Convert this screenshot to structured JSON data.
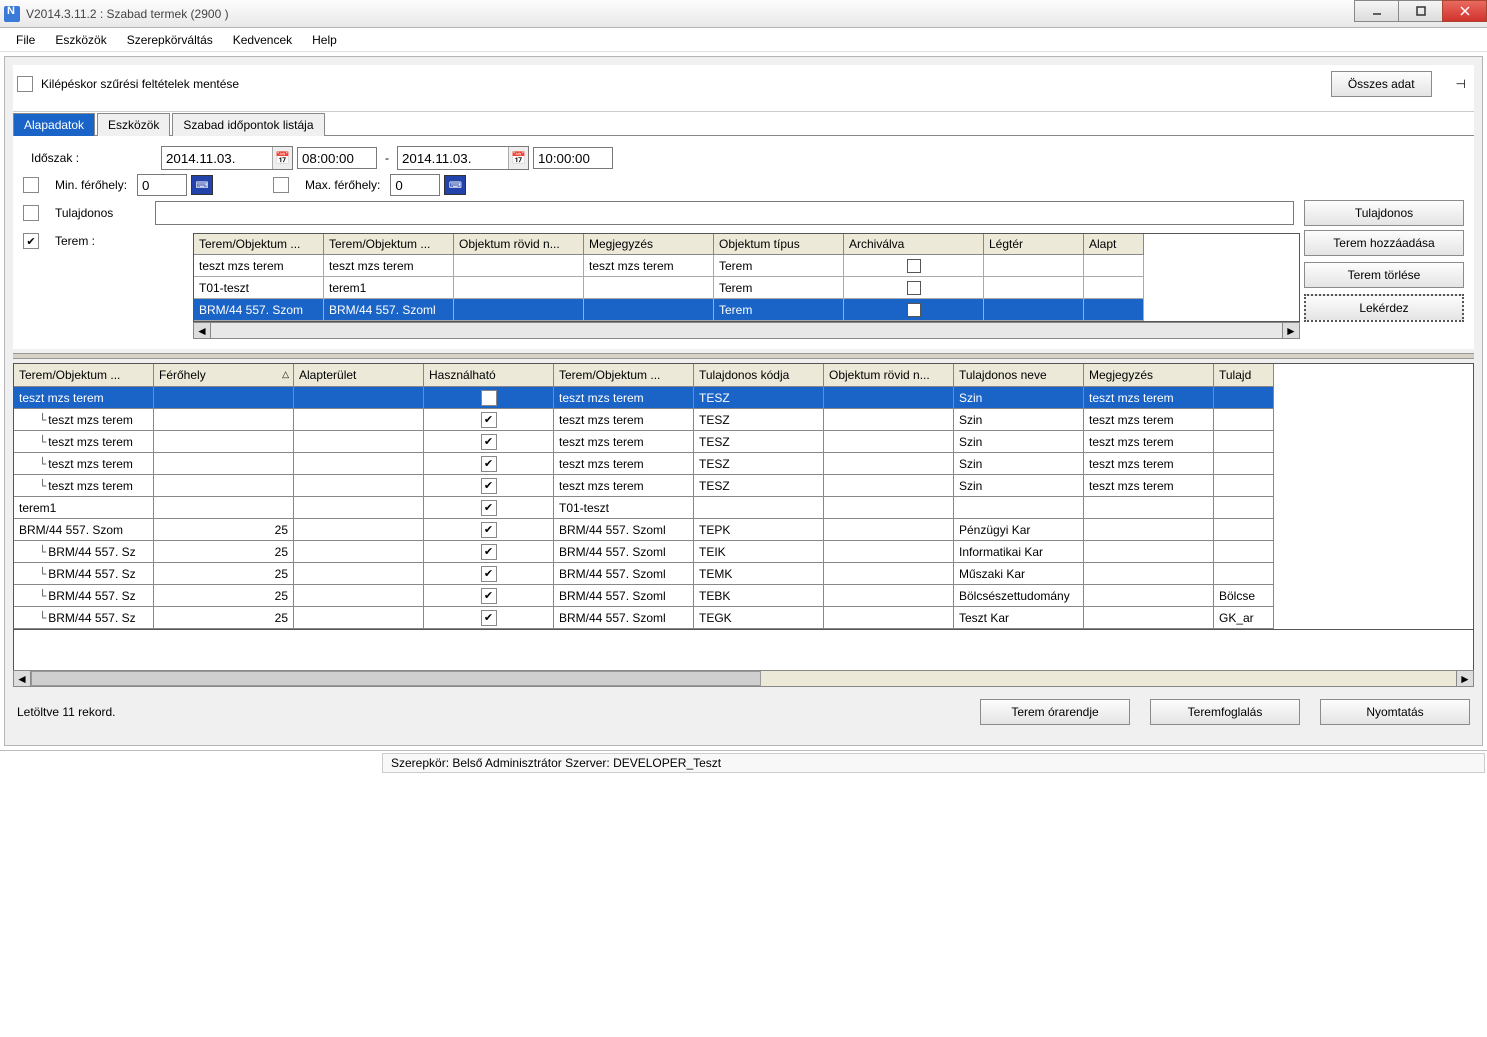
{
  "window": {
    "title": "V2014.3.11.2 : Szabad termek (2900  )"
  },
  "menu": [
    "File",
    "Eszközök",
    "Szerepkörváltás",
    "Kedvencek",
    "Help"
  ],
  "toolbar": {
    "save_filter_label": "Kilépéskor szűrési feltételek mentése",
    "all_data_btn": "Összes adat"
  },
  "tabs": [
    {
      "label": "Alapadatok",
      "active": true
    },
    {
      "label": "Eszközök",
      "active": false
    },
    {
      "label": "Szabad időpontok listája",
      "active": false
    }
  ],
  "filters": {
    "idoszak_label": "Időszak :",
    "date_from": "2014.11.03.",
    "time_from": "08:00:00",
    "date_to": "2014.11.03.",
    "time_to": "10:00:00",
    "min_ferhely_label": "Min. férőhely:",
    "min_ferhely": "0",
    "max_ferhely_label": "Max. férőhely:",
    "max_ferhely": "0",
    "tulajdonos_label": "Tulajdonos",
    "tulajdonos_value": "",
    "terem_label": "Terem :"
  },
  "buttons": {
    "tulajdonos": "Tulajdonos",
    "terem_add": "Terem hozzáadása",
    "terem_del": "Terem törlése",
    "lekerdez": "Lekérdez",
    "terem_orarend": "Terem órarendje",
    "teremfoglalas": "Teremfoglalás",
    "nyomtatas": "Nyomtatás"
  },
  "terem_grid": {
    "headers": [
      "Terem/Objektum ...",
      "Terem/Objektum ...",
      "Objektum rövid n...",
      "Megjegyzés",
      "Objektum típus",
      "Archiválva",
      "Légtér",
      "Alapt"
    ],
    "rows": [
      {
        "name": "teszt mzs terem",
        "name2": "teszt mzs terem",
        "rov": "",
        "meg": "teszt mzs terem",
        "tip": "Terem",
        "arch": false,
        "leg": "",
        "alap": "",
        "selected": false
      },
      {
        "name": "T01-teszt",
        "name2": "terem1",
        "rov": "",
        "meg": "",
        "tip": "Terem",
        "arch": false,
        "leg": "",
        "alap": "",
        "selected": false
      },
      {
        "name": "BRM/44 557. Szom",
        "name2": "BRM/44 557. Szoml",
        "rov": "",
        "meg": "",
        "tip": "Terem",
        "arch": false,
        "leg": "",
        "alap": "",
        "selected": true
      }
    ]
  },
  "main_grid": {
    "headers": [
      "Terem/Objektum ...",
      "Férőhely",
      "Alapterület",
      "Használható",
      "Terem/Objektum ...",
      "Tulajdonos kódja",
      "Objektum rövid n...",
      "Tulajdonos neve",
      "Megjegyzés",
      "Tulajd"
    ],
    "sort_col": 1,
    "rows": [
      {
        "indent": 0,
        "name": "teszt mzs terem",
        "fer": "",
        "alap": "",
        "haszn": true,
        "to": "teszt mzs terem",
        "tk": "TESZ",
        "or": "",
        "tn": "Szin",
        "meg": "teszt mzs terem",
        "tu": "",
        "selected": true
      },
      {
        "indent": 1,
        "name": "teszt mzs terem",
        "fer": "",
        "alap": "",
        "haszn": true,
        "to": "teszt mzs terem",
        "tk": "TESZ",
        "or": "",
        "tn": "Szin",
        "meg": "teszt mzs terem",
        "tu": "",
        "selected": false
      },
      {
        "indent": 1,
        "name": "teszt mzs terem",
        "fer": "",
        "alap": "",
        "haszn": true,
        "to": "teszt mzs terem",
        "tk": "TESZ",
        "or": "",
        "tn": "Szin",
        "meg": "teszt mzs terem",
        "tu": "",
        "selected": false
      },
      {
        "indent": 1,
        "name": "teszt mzs terem",
        "fer": "",
        "alap": "",
        "haszn": true,
        "to": "teszt mzs terem",
        "tk": "TESZ",
        "or": "",
        "tn": "Szin",
        "meg": "teszt mzs terem",
        "tu": "",
        "selected": false
      },
      {
        "indent": 1,
        "name": "teszt mzs terem",
        "fer": "",
        "alap": "",
        "haszn": true,
        "to": "teszt mzs terem",
        "tk": "TESZ",
        "or": "",
        "tn": "Szin",
        "meg": "teszt mzs terem",
        "tu": "",
        "selected": false
      },
      {
        "indent": 0,
        "name": "terem1",
        "fer": "",
        "alap": "",
        "haszn": true,
        "to": "T01-teszt",
        "tk": "",
        "or": "",
        "tn": "",
        "meg": "",
        "tu": "",
        "selected": false
      },
      {
        "indent": 0,
        "name": "BRM/44 557. Szom",
        "fer": "25",
        "alap": "",
        "haszn": true,
        "to": "BRM/44 557. Szoml",
        "tk": "TEPK",
        "or": "",
        "tn": "Pénzügyi Kar",
        "meg": "",
        "tu": "",
        "selected": false
      },
      {
        "indent": 1,
        "name": "BRM/44 557. Sz",
        "fer": "25",
        "alap": "",
        "haszn": true,
        "to": "BRM/44 557. Szoml",
        "tk": "TEIK",
        "or": "",
        "tn": "Informatikai Kar",
        "meg": "",
        "tu": "",
        "selected": false
      },
      {
        "indent": 1,
        "name": "BRM/44 557. Sz",
        "fer": "25",
        "alap": "",
        "haszn": true,
        "to": "BRM/44 557. Szoml",
        "tk": "TEMK",
        "or": "",
        "tn": "Műszaki Kar",
        "meg": "",
        "tu": "",
        "selected": false
      },
      {
        "indent": 1,
        "name": "BRM/44 557. Sz",
        "fer": "25",
        "alap": "",
        "haszn": true,
        "to": "BRM/44 557. Szoml",
        "tk": "TEBK",
        "or": "",
        "tn": "Bölcsészettudomány",
        "meg": "",
        "tu": "Bölcse",
        "selected": false
      },
      {
        "indent": 1,
        "name": "BRM/44 557. Sz",
        "fer": "25",
        "alap": "",
        "haszn": true,
        "to": "BRM/44 557. Szoml",
        "tk": "TEGK",
        "or": "",
        "tn": "Teszt Kar",
        "meg": "",
        "tu": "GK_ar",
        "selected": false
      }
    ]
  },
  "footer": {
    "status": "Letöltve 11 rekord."
  },
  "statusbar": {
    "text": "Szerepkör: Belső Adminisztrátor   Szerver: DEVELOPER_Teszt"
  }
}
